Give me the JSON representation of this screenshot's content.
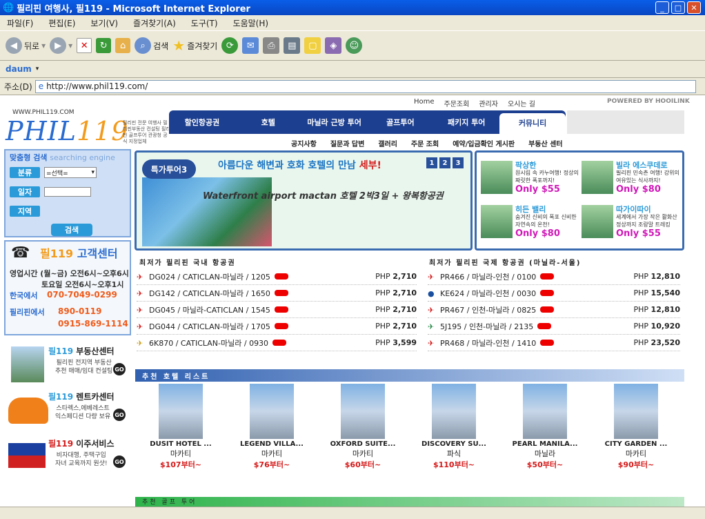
{
  "window": {
    "title": "필리핀 여행사, 필119 - Microsoft Internet Explorer"
  },
  "menu": [
    "파일(F)",
    "편집(E)",
    "보기(V)",
    "즐겨찾기(A)",
    "도구(T)",
    "도움말(H)"
  ],
  "toolbar": {
    "back": "뒤로",
    "search": "검색",
    "favorites": "즐겨찾기"
  },
  "addressbar": {
    "label": "주소(D)",
    "url": "http://www.phil119.com/"
  },
  "site": {
    "top_links": [
      "Home",
      "주문조회",
      "관리자",
      "오시는 길"
    ],
    "powered": "POWERED BY HOOILINK",
    "domain": "WWW.PHIL119.COM",
    "logo": "PHIL",
    "logo_num": "119",
    "tagline": "필리핀 전문 여행사 필리핀부동산 컨설팅 필리핀 골프투어 관광청 공식 지정업체",
    "nav": [
      "할인항공권",
      "호텔",
      "마닐라 근방 투어",
      "골프투어",
      "패키지 투어",
      "커뮤니티"
    ],
    "subnav": [
      "공지사항",
      "질문과 답변",
      "갤러리",
      "주문 조회",
      "예약/입금확인 게시판",
      "부동산 센터"
    ]
  },
  "search": {
    "title": "맞춤형 검색",
    "title_en": "searching engine",
    "labels": [
      "분류",
      "일자",
      "지역"
    ],
    "select_value": "=선택=",
    "button": "검색"
  },
  "cs": {
    "title_num": "필119",
    "title": "고객센터",
    "hours1": "영업시간 (월~금) 오전6시~오후6시",
    "hours2": "토요일 오전6시~오후1시",
    "korea_label": "한국에서",
    "korea_phone": "070-7049-0299",
    "ph_label": "필리핀에서",
    "ph_phone1": "890-0119",
    "ph_phone2": "0915-869-1114"
  },
  "side": [
    {
      "num": "필119",
      "title": "부동산센터",
      "desc1": "필리핀 전지역 부동산",
      "desc2": "추천 매매/임대 컨설팅",
      "go": "GO"
    },
    {
      "num": "필119",
      "title": "렌트카센터",
      "desc1": "스타렉스,에베레스트",
      "desc2": "익스페디션 다량 보유",
      "go": "GO"
    },
    {
      "num": "필119",
      "title": "이주서비스",
      "desc1": "비자대행, 주택구입",
      "desc2": "자녀 교육까지 원샷!",
      "go": "GO"
    }
  ],
  "promo": {
    "badge": "특가투어3",
    "headline": "아름다운 해변과 호화 호텔의 만남",
    "headline_accent": "세부!",
    "pages": [
      "1",
      "2",
      "3"
    ],
    "subtitle": "Waterfront airport mactan 호텔 2박3일 + 왕복항공권"
  },
  "deals": [
    {
      "title": "팍상한",
      "desc": "원시림 속 카누여행! 정상의 짜릿한 폭포까지!",
      "price": "Only $55"
    },
    {
      "title": "빌라 에스쿠데로",
      "desc": "필리핀 민속촌 여행! 강위의 여유있는 식사까지!",
      "price": "Only $80"
    },
    {
      "title": "히든 밸리",
      "desc": "숨겨진 신비의 폭포 신비한 자연속의 온천!",
      "price": "Only $80"
    },
    {
      "title": "따가이따이",
      "desc": "세계에서 가장 작은 활화산 정상까지 조랑말 트레킹",
      "price": "Only $55"
    }
  ],
  "domestic": {
    "title": "최저가 필리핀 국내 항공권",
    "rows": [
      {
        "code": "DG024 / CATICLAN-마닐라 / 1205",
        "currency": "PHP",
        "price": "2,710"
      },
      {
        "code": "DG142 / CATICLAN-마닐라 / 1650",
        "currency": "PHP",
        "price": "2,710"
      },
      {
        "code": "DG045 / 마닐라-CATICLAN / 1545",
        "currency": "PHP",
        "price": "2,710"
      },
      {
        "code": "DG044 / CATICLAN-마닐라 / 1705",
        "currency": "PHP",
        "price": "2,710"
      },
      {
        "code": "6K870 / CATICLAN-마닐라 / 0930",
        "currency": "PHP",
        "price": "3,599"
      }
    ]
  },
  "international": {
    "title": "최저가 필리핀 국제 항공권 (마닐라-서울)",
    "rows": [
      {
        "code": "PR466 / 마닐라-인천 / 0100",
        "currency": "PHP",
        "price": "12,810"
      },
      {
        "code": "KE624 / 마닐라-인천 / 0030",
        "currency": "PHP",
        "price": "15,540"
      },
      {
        "code": "PR467 / 인천-마닐라 / 0825",
        "currency": "PHP",
        "price": "12,810"
      },
      {
        "code": "5J195 / 인천-마닐라 / 2135",
        "currency": "PHP",
        "price": "10,920"
      },
      {
        "code": "PR468 / 마닐라-인천 / 1410",
        "currency": "PHP",
        "price": "23,520"
      }
    ]
  },
  "hotels": {
    "title": "추천 호텔 리스트",
    "items": [
      {
        "name": "DUSIT HOTEL ...",
        "location": "마카티",
        "price": "$107부터~"
      },
      {
        "name": "LEGEND VILLA...",
        "location": "마카티",
        "price": "$76부터~"
      },
      {
        "name": "OXFORD SUITE...",
        "location": "마카티",
        "price": "$60부터~"
      },
      {
        "name": "DISCOVERY SU...",
        "location": "파식",
        "price": "$110부터~"
      },
      {
        "name": "PEARL MANILA...",
        "location": "마닐라",
        "price": "$50부터~"
      },
      {
        "name": "CITY GARDEN ...",
        "location": "마카티",
        "price": "$90부터~"
      }
    ]
  },
  "golf": {
    "title": "추천 골프 투어"
  }
}
